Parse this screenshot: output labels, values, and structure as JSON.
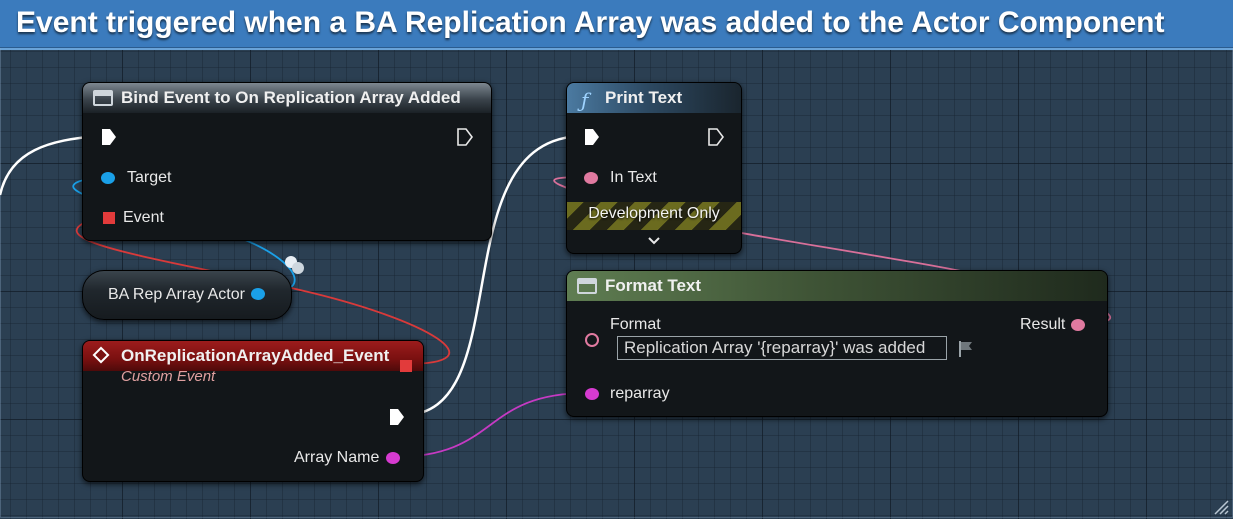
{
  "comment": {
    "title": "Event triggered when a BA Replication Array was added to the Actor Component",
    "color": "#3b7bbd"
  },
  "nodes": {
    "bind_event": {
      "title": "Bind Event to On Replication Array Added",
      "icon": "function-node-icon",
      "pins": {
        "target": "Target",
        "event": "Event"
      }
    },
    "variable": {
      "label": "BA Rep Array Actor"
    },
    "custom_event": {
      "title": "OnReplicationArrayAdded_Event",
      "subtitle": "Custom Event",
      "icon": "event-diamond-icon",
      "pins": {
        "array_name": "Array Name"
      }
    },
    "print_text": {
      "title": "Print Text",
      "icon": "function-f-icon",
      "pins": {
        "in_text": "In Text"
      },
      "development_label": "Development Only"
    },
    "format_text": {
      "title": "Format Text",
      "icon": "function-node-icon",
      "pins": {
        "format": "Format",
        "result": "Result",
        "reparray": "reparray"
      },
      "format_value": "Replication Array '{reparray}' was added"
    }
  },
  "colors": {
    "exec": "#ffffff",
    "object": "#1aa0e8",
    "delegate": "#e23b3b",
    "text": "#e07aa0",
    "name": "#d63bd0"
  }
}
